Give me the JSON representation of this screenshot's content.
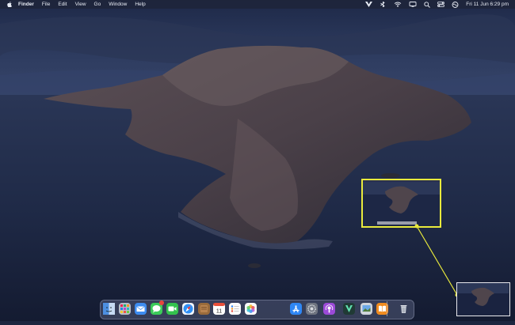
{
  "menu_bar": {
    "app_name": "Finder",
    "items": [
      "File",
      "Edit",
      "View",
      "Go",
      "Window",
      "Help"
    ],
    "clock": "Fri 11 Jun  6:29 pm"
  },
  "dock": {
    "calendar_day": "11",
    "apps": [
      "finder",
      "launchpad",
      "mail",
      "messages",
      "facetime",
      "safari",
      "notes-brown",
      "calendar",
      "reminders",
      "photos",
      "app-store",
      "system-preferences",
      "podcasts",
      "vectorize",
      "preview",
      "books"
    ]
  },
  "screenshot_thumbnail": {
    "highlight_color": "#e9ea3c"
  }
}
